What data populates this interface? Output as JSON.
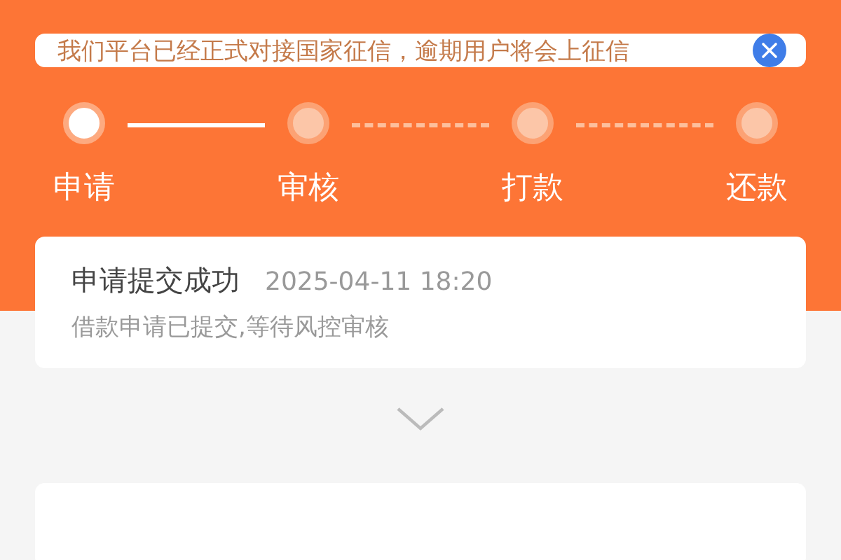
{
  "notice": {
    "text": "我们平台已经正式对接国家征信，逾期用户将会上征信"
  },
  "steps": [
    {
      "label": "申请",
      "done": true
    },
    {
      "label": "审核",
      "done": false
    },
    {
      "label": "打款",
      "done": false
    },
    {
      "label": "还款",
      "done": false
    }
  ],
  "status_card": {
    "title": "申请提交成功",
    "time": "2025-04-11 18:20",
    "description": "借款申请已提交,等待风控审核"
  }
}
